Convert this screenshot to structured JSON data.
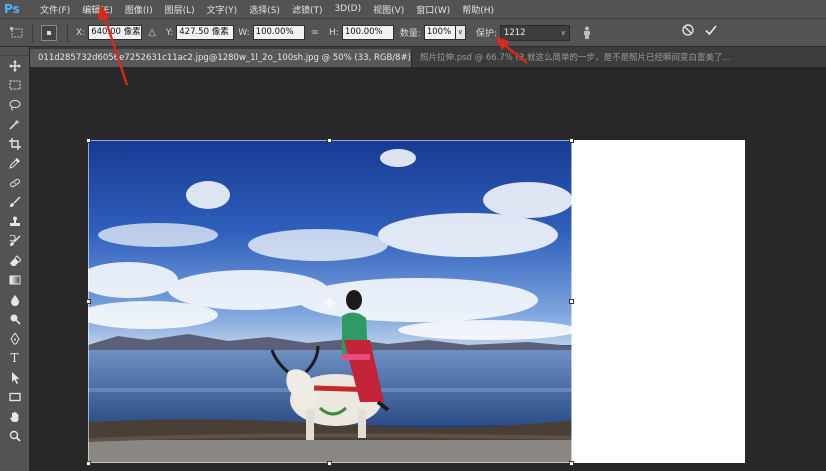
{
  "app": {
    "logo": "Ps"
  },
  "menu": [
    "文件(F)",
    "编辑(E)",
    "图像(I)",
    "图层(L)",
    "文字(Y)",
    "选择(S)",
    "滤镜(T)",
    "3D(D)",
    "视图(V)",
    "窗口(W)",
    "帮助(H)"
  ],
  "options": {
    "x_label": "X:",
    "x_value": "640.00 像素",
    "y_label": "Y:",
    "y_value": "427.50 像素",
    "w_label": "W:",
    "w_value": "100.00%",
    "h_label": "H:",
    "h_value": "100.00%",
    "amount_label": "数量:",
    "amount_value": "100%",
    "protect_label": "保护:",
    "protect_value": "1212"
  },
  "tabs": [
    {
      "label": "011d285732d6056e7252631c11ac2.jpg@1280w_1l_2o_100sh.jpg @ 50% (33, RGB/8#) *",
      "close": "×"
    },
    {
      "label": "照片拉伸.psd @ 66.7% (3.就这么简单的一步，是不是照片已经瞬间变白富美了..."
    }
  ],
  "tools": [
    "move-tool",
    "marquee-tool",
    "lasso-tool",
    "quick-select-tool",
    "crop-tool",
    "eyedropper-tool",
    "healing-brush-tool",
    "brush-tool",
    "clone-stamp-tool",
    "history-brush-tool",
    "eraser-tool",
    "gradient-tool",
    "blur-tool",
    "dodge-tool",
    "pen-tool",
    "type-tool",
    "path-select-tool",
    "rectangle-tool",
    "hand-tool",
    "zoom-tool"
  ],
  "type_tool_glyph": "T",
  "colors": {
    "annotation": "#e0261b",
    "ui_panel": "#535353",
    "ui_dark": "#282828",
    "ps_blue": "#4fb3ff"
  }
}
